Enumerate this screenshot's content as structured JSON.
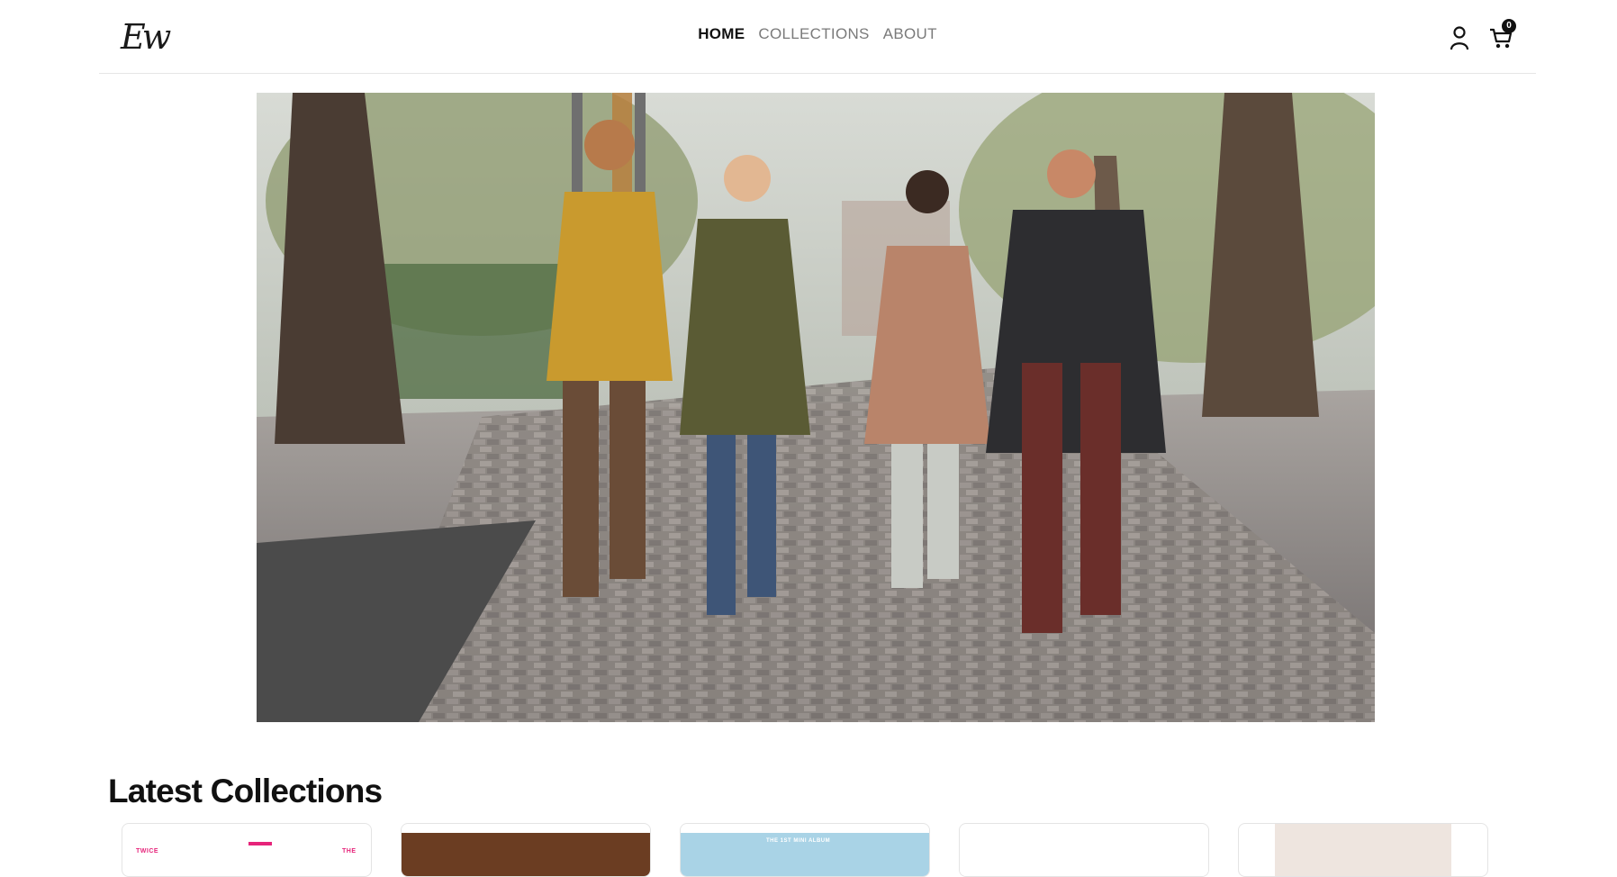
{
  "header": {
    "logo_text": "Ew",
    "nav": {
      "home": "HOME",
      "collections": "COLLECTIONS",
      "about": "ABOUT"
    },
    "cart_count": "0",
    "icons": [
      "user-icon",
      "cart-icon"
    ]
  },
  "hero": {
    "image_subject": "four-friends-walking-park-photo"
  },
  "latest": {
    "title": "Latest Collections",
    "cards": [
      {
        "tags": [
          "TWICE",
          "THE"
        ],
        "accent": "#e6247a"
      },
      {
        "tags": [],
        "accent": "#6b3d22"
      },
      {
        "tags": [
          "THE 1ST MINI ALBUM"
        ],
        "accent": "#a9d3e6"
      },
      {
        "tags": [],
        "accent": "#ffffff"
      },
      {
        "tags": [],
        "accent": "#eee5df"
      }
    ]
  },
  "colors": {
    "text": "#111111",
    "muted_nav": "#7a7a7a",
    "border": "#e6e6e6"
  }
}
